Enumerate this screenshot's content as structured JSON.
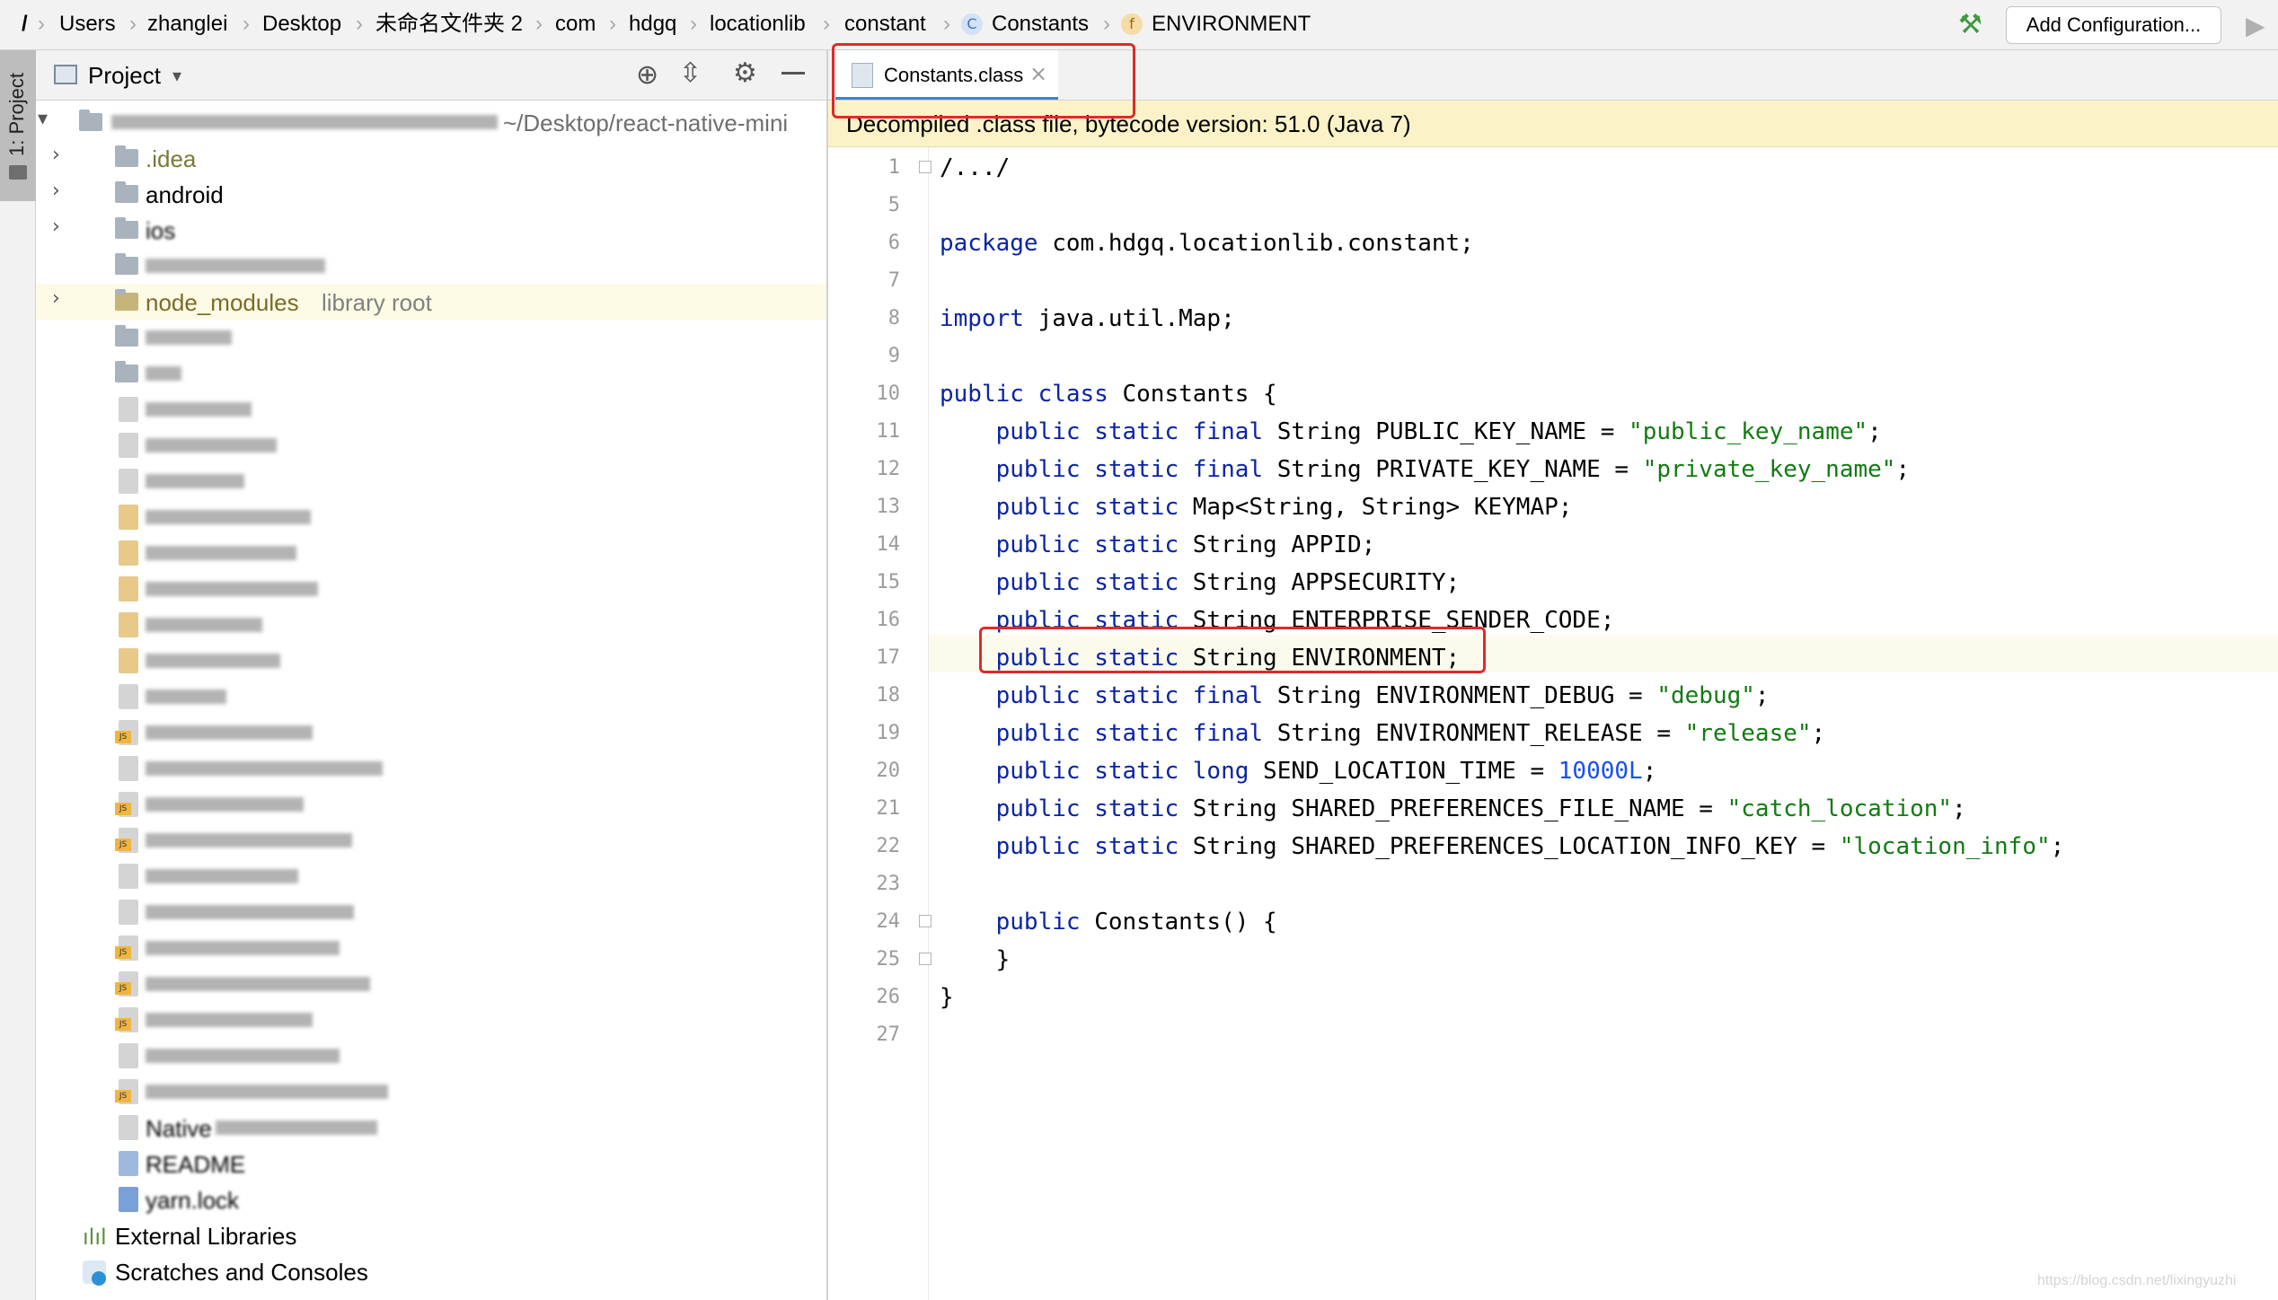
{
  "breadcrumb": {
    "root": "/",
    "items": [
      "Users",
      "zhanglei",
      "Desktop",
      "未命名文件夹 2",
      "com",
      "hdgq",
      "locationlib",
      "constant",
      "Constants",
      "ENVIRONMENT"
    ],
    "class_icon_letter": "C",
    "field_icon_letter": "f"
  },
  "toolbar": {
    "add_configuration_label": "Add Configuration..."
  },
  "tool_strip": {
    "project_label": "1: Project"
  },
  "project_panel": {
    "title": "Project",
    "root_path": "~/Desktop/react-native-mini",
    "items": [
      {
        "label": ".idea"
      },
      {
        "label": "android"
      },
      {
        "label": "ios"
      },
      {
        "label": "node_modules",
        "suffix": "library root"
      },
      {
        "label": "External Libraries"
      },
      {
        "label": "Scratches and Consoles"
      }
    ],
    "blurred_labels": [
      "README",
      "yarn.lock",
      "Native"
    ]
  },
  "editor": {
    "tab_label": "Constants.class",
    "notice": "Decompiled .class file, bytecode version: 51.0 (Java 7)",
    "lines": [
      {
        "n": "1",
        "html_key": "l1"
      },
      {
        "n": "5"
      },
      {
        "n": "6"
      },
      {
        "n": "7"
      },
      {
        "n": "8"
      },
      {
        "n": "9"
      },
      {
        "n": "10"
      },
      {
        "n": "11"
      },
      {
        "n": "12"
      },
      {
        "n": "13"
      },
      {
        "n": "14"
      },
      {
        "n": "15"
      },
      {
        "n": "16"
      },
      {
        "n": "17"
      },
      {
        "n": "18"
      },
      {
        "n": "19"
      },
      {
        "n": "20"
      },
      {
        "n": "21"
      },
      {
        "n": "22"
      },
      {
        "n": "23"
      },
      {
        "n": "24"
      },
      {
        "n": "25"
      },
      {
        "n": "26"
      },
      {
        "n": "27"
      }
    ],
    "code": {
      "l1": "/.../",
      "l6_kw": "package",
      "l6_rest": " com.hdgq.locationlib.constant;",
      "l8_kw": "import",
      "l8_rest": " java.util.Map;",
      "l10_kw": "public class",
      "l10_rest": " Constants {",
      "l11_kw": "public static final",
      "l11_rest": " String PUBLIC_KEY_NAME = ",
      "l11_str": "\"public_key_name\"",
      "l12_kw": "public static final",
      "l12_rest": " String PRIVATE_KEY_NAME = ",
      "l12_str": "\"private_key_name\"",
      "l13_kw": "public static",
      "l13_rest": " Map<String, String> KEYMAP;",
      "l14_kw": "public static",
      "l14_rest": " String APPID;",
      "l15_kw": "public static",
      "l15_rest": " String APPSECURITY;",
      "l16_kw": "public static",
      "l16_rest": " String ENTERPRISE_SENDER_CODE;",
      "l17_kw": "public static",
      "l17_rest": " String ENVIRONMENT;",
      "l18_kw": "public static final",
      "l18_rest": " String ENVIRONMENT_DEBUG = ",
      "l18_str": "\"debug\"",
      "l19_kw": "public static final",
      "l19_rest": " String ENVIRONMENT_RELEASE = ",
      "l19_str": "\"release\"",
      "l20_kw": "public static long",
      "l20_rest": " SEND_LOCATION_TIME = ",
      "l20_num": "10000L",
      "l21_kw": "public static",
      "l21_rest": " String SHARED_PREFERENCES_FILE_NAME = ",
      "l21_str": "\"catch_location\"",
      "l22_kw": "public static",
      "l22_rest": " String SHARED_PREFERENCES_LOCATION_INFO_KEY = ",
      "l22_str": "\"location_info\"",
      "l24_kw": "public",
      "l24_rest": " Constants() {",
      "l25": "}",
      "l26": "}",
      "semicolon": ";"
    }
  },
  "watermark": "https://blog.csdn.net/lixingyuzhi",
  "colors": {
    "keyword": "#0a24a3",
    "string": "#127a12",
    "number": "#1750eb",
    "highlight_box": "#e02a2a"
  }
}
